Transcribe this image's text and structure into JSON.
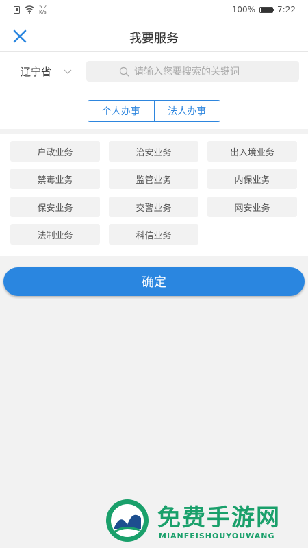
{
  "status_bar": {
    "speed_value": "5.2",
    "speed_unit": "K/s",
    "battery_percent": "100%",
    "battery_level": 1.0,
    "time": "7:22"
  },
  "header": {
    "title": "我要服务",
    "close_icon": "close-icon"
  },
  "search": {
    "province": "辽宁省",
    "placeholder": "请输入您要搜索的关键词"
  },
  "tabs": [
    {
      "label": "个人办事"
    },
    {
      "label": "法人办事"
    }
  ],
  "services": [
    {
      "label": "户政业务"
    },
    {
      "label": "治安业务"
    },
    {
      "label": "出入境业务"
    },
    {
      "label": "禁毒业务"
    },
    {
      "label": "监管业务"
    },
    {
      "label": "内保业务"
    },
    {
      "label": "保安业务"
    },
    {
      "label": "交警业务"
    },
    {
      "label": "网安业务"
    },
    {
      "label": "法制业务"
    },
    {
      "label": "科信业务"
    }
  ],
  "confirm_label": "确定",
  "watermark": {
    "title": "免费手游网",
    "subtitle": "MIANFEISHOUYOUWANG"
  },
  "colors": {
    "accent": "#2a86e0",
    "tab_border": "#2e86de",
    "watermark": "#1aa06b"
  }
}
